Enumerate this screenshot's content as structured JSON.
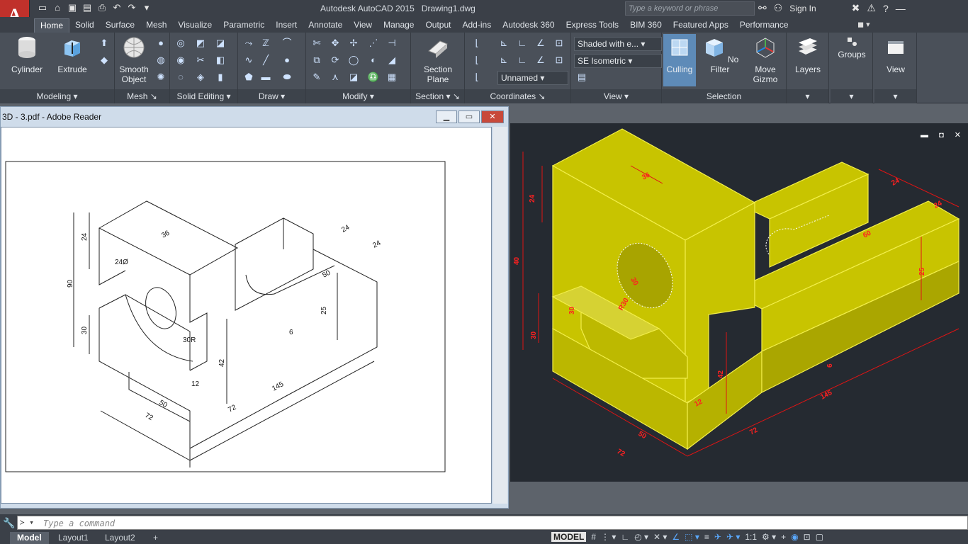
{
  "window": {
    "app_name": "Autodesk AutoCAD 2015",
    "document": "Drawing1.dwg",
    "search_placeholder": "Type a keyword or phrase",
    "sign_in": "Sign In"
  },
  "tabs": [
    "Home",
    "Solid",
    "Surface",
    "Mesh",
    "Visualize",
    "Parametric",
    "Insert",
    "Annotate",
    "View",
    "Manage",
    "Output",
    "Add-ins",
    "Autodesk 360",
    "Express Tools",
    "BIM 360",
    "Featured Apps",
    "Performance"
  ],
  "active_tab": "Home",
  "ribbon": {
    "modeling": {
      "title": "Modeling",
      "cylinder": "Cylinder",
      "extrude": "Extrude"
    },
    "mesh": {
      "title": "Mesh",
      "smooth_object_1": "Smooth",
      "smooth_object_2": "Object"
    },
    "solid_editing": {
      "title": "Solid Editing"
    },
    "draw": {
      "title": "Draw"
    },
    "modify": {
      "title": "Modify"
    },
    "section": {
      "title": "Section",
      "section_plane_1": "Section",
      "section_plane_2": "Plane"
    },
    "coordinates": {
      "title": "Coordinates",
      "ucs_name": "Unnamed"
    },
    "view": {
      "title": "View",
      "visual_style": "Shaded with e...",
      "view_direction": "SE Isometric"
    },
    "selection": {
      "title": "Selection",
      "culling": "Culling",
      "no_filter": "No Filter",
      "move_gizmo_1": "Move",
      "move_gizmo_2": "Gizmo"
    },
    "layers": {
      "label": "Layers"
    },
    "groups": {
      "label": "Groups"
    },
    "view_btn": {
      "label": "View"
    }
  },
  "reader": {
    "title": "3D - 3.pdf - Adobe Reader",
    "drawing": {
      "dims": [
        "90",
        "24",
        "36",
        "24Ø",
        "30",
        "30R",
        "24",
        "24",
        "50",
        "25",
        "6",
        "42",
        "12",
        "72",
        "145",
        "50",
        "72"
      ]
    }
  },
  "model_dims": {
    "labels": [
      "24",
      "36",
      "24",
      "24",
      "60",
      "40",
      "30",
      "25",
      "30",
      "30",
      "R30",
      "12",
      "42",
      "6",
      "72",
      "145",
      "50",
      "72"
    ]
  },
  "command": {
    "placeholder": "Type a command"
  },
  "status": {
    "layouts": [
      "Model",
      "Layout1",
      "Layout2"
    ],
    "model_btn": "MODEL",
    "scale": "1:1"
  }
}
